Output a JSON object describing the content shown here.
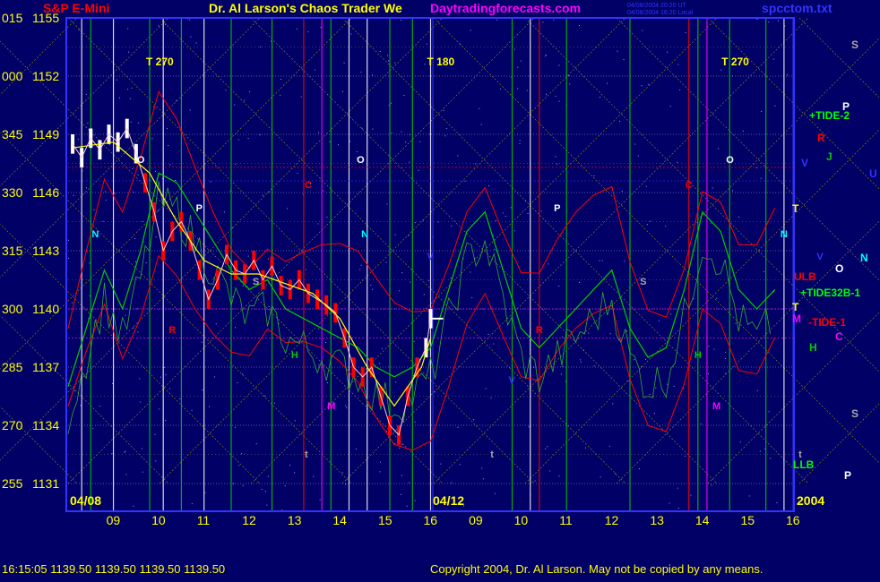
{
  "header": {
    "symbol": "S&P E-Mini",
    "title": "Dr. Al Larson's Chaos Trader We",
    "site": "Daytradingforecasts.com",
    "file": "spcctom.txt",
    "stamp1": "04/08/2004 20:20 UT",
    "stamp2": "04/08/2004 16:20 Local"
  },
  "footer": {
    "quote": "16:15:05   1139.50 1139.50 1139.50 1139.50",
    "copyright": "Copyright 2004, Dr. Al Larson. May not be copied by any means."
  },
  "colors": {
    "background": "#000066",
    "plot_border": "#3333ff",
    "yellow": "#ffff00",
    "white": "#ffffff",
    "red": "#ff0000",
    "green": "#00cc00",
    "magenta": "#ff00ff",
    "cyan": "#00ffff",
    "blue": "#3333ff"
  },
  "chart_data": {
    "type": "line",
    "title": "S&P E-Mini",
    "y_ticks": [
      {
        "angle": "015",
        "price": "1155"
      },
      {
        "angle": "000",
        "price": "1152"
      },
      {
        "angle": "345",
        "price": "1149"
      },
      {
        "angle": "330",
        "price": "1146"
      },
      {
        "angle": "315",
        "price": "1143"
      },
      {
        "angle": "300",
        "price": "1140"
      },
      {
        "angle": "285",
        "price": "1137"
      },
      {
        "angle": "270",
        "price": "1134"
      },
      {
        "angle": "255",
        "price": "1131"
      }
    ],
    "ylim": [
      1131,
      1155
    ],
    "x_ticks": [
      "09",
      "10",
      "11",
      "12",
      "13",
      "14",
      "15",
      "16",
      "09",
      "10",
      "11",
      "12",
      "13",
      "14",
      "15",
      "16"
    ],
    "date_labels": [
      "04/08",
      "04/12",
      "2004"
    ],
    "price_series": {
      "name": "S&P E-Mini",
      "x": [
        8.1,
        8.3,
        8.5,
        8.7,
        8.9,
        9.1,
        9.3,
        9.5,
        9.7,
        9.9,
        10.1,
        10.3,
        10.5,
        10.7,
        10.9,
        11.1,
        11.3,
        11.5,
        11.7,
        11.9,
        12.1,
        12.3,
        12.5,
        12.7,
        12.9,
        13.1,
        13.3,
        13.5,
        13.7,
        13.9,
        14.1,
        14.3,
        14.5,
        14.7,
        14.9,
        15.1,
        15.3,
        15.5,
        15.7,
        15.9,
        16.0
      ],
      "values": [
        1148.5,
        1147.8,
        1148.8,
        1148.2,
        1149.0,
        1148.6,
        1149.3,
        1148.0,
        1146.5,
        1145.0,
        1143.0,
        1144.0,
        1144.5,
        1143.5,
        1142.0,
        1140.5,
        1141.5,
        1142.8,
        1142.0,
        1141.8,
        1142.5,
        1141.5,
        1142.2,
        1141.2,
        1141.0,
        1141.5,
        1140.8,
        1140.5,
        1140.2,
        1139.8,
        1138.5,
        1137.0,
        1136.5,
        1137.0,
        1135.5,
        1134.0,
        1133.5,
        1135.5,
        1137.0,
        1138.0,
        1139.5
      ]
    },
    "tide_series": {
      "name": "green tide",
      "x": [
        8.0,
        8.4,
        8.8,
        9.2,
        9.6,
        10.0,
        10.4,
        10.8,
        11.2,
        11.6,
        12.0,
        12.4,
        12.8,
        13.2,
        13.6,
        14.0,
        14.4,
        14.8,
        15.2,
        15.6,
        16.0,
        16.4,
        16.8,
        17.2,
        17.6,
        18.0,
        18.4,
        18.8,
        19.2,
        19.6,
        20.0,
        20.4,
        20.8,
        21.2,
        21.6,
        22.0,
        22.4,
        22.8,
        23.2,
        23.6
      ],
      "values": [
        1136,
        1139,
        1142,
        1140,
        1143,
        1147,
        1146.5,
        1145,
        1143.5,
        1142,
        1141,
        1141.5,
        1140,
        1139.5,
        1139,
        1138.5,
        1138,
        1137,
        1136.5,
        1137,
        1138,
        1141,
        1144,
        1145,
        1142,
        1139,
        1138,
        1139,
        1140,
        1141,
        1142,
        1139,
        1137.5,
        1138,
        1141,
        1145,
        1144,
        1141,
        1140,
        1141
      ]
    },
    "ma_series": {
      "name": "yellow average",
      "x": [
        8.1,
        9.0,
        9.8,
        10.4,
        11.0,
        11.6,
        12.2,
        12.8,
        13.4,
        14.0,
        14.6,
        15.2,
        15.8,
        16.0
      ],
      "values": [
        1148.3,
        1148.6,
        1147.0,
        1144.5,
        1142.5,
        1141.8,
        1141.8,
        1141.3,
        1140.8,
        1139.5,
        1137.0,
        1135.0,
        1137.0,
        1138.5
      ]
    },
    "legend_labels": [
      {
        "text": "+TIDE-2",
        "color": "#00ff00"
      },
      {
        "text": "R",
        "color": "#ff0000"
      },
      {
        "text": "J",
        "color": "#00cc00"
      },
      {
        "text": "V",
        "color": "#3333ff"
      },
      {
        "text": "U",
        "color": "#3333ff"
      },
      {
        "text": "T",
        "color": "#ffff00"
      },
      {
        "text": "ULB",
        "color": "#ff0000"
      },
      {
        "text": "O",
        "color": "#ffffff"
      },
      {
        "text": "N",
        "color": "#00ffff"
      },
      {
        "text": "+TIDE32B-1",
        "color": "#00ff00"
      },
      {
        "text": "T",
        "color": "#ffff00"
      },
      {
        "text": "M",
        "color": "#ff00ff"
      },
      {
        "text": "-TIDE-1",
        "color": "#ff0000"
      },
      {
        "text": "C",
        "color": "#ff00ff"
      },
      {
        "text": "H",
        "color": "#00cc00"
      },
      {
        "text": "S",
        "color": "#aaaaaa"
      },
      {
        "text": "S",
        "color": "#aaaaaa"
      },
      {
        "text": "P",
        "color": "#ffffff"
      },
      {
        "text": "LLB",
        "color": "#00ff00"
      },
      {
        "text": "P",
        "color": "#ffffff"
      }
    ],
    "marker_labels": [
      {
        "text": "T 270",
        "x": 9.8,
        "color": "#ffff00"
      },
      {
        "text": "T 180",
        "x": 16.0,
        "color": "#ffff00"
      },
      {
        "text": "T 270",
        "x": 22.5,
        "color": "#ffff00"
      },
      {
        "text": "O",
        "x": 9.6,
        "color": "#ffffff"
      },
      {
        "text": "O",
        "x": 14.45,
        "color": "#ffffff"
      },
      {
        "text": "O",
        "x": 22.6,
        "color": "#ffffff"
      },
      {
        "text": "P",
        "x": 10.9,
        "color": "#ffffff"
      },
      {
        "text": "P",
        "x": 18.8,
        "color": "#ffffff"
      },
      {
        "text": "C",
        "x": 13.3,
        "color": "#ff0000"
      },
      {
        "text": "C",
        "x": 21.7,
        "color": "#ff0000"
      },
      {
        "text": "N",
        "x": 8.6,
        "color": "#00ffff"
      },
      {
        "text": "N",
        "x": 14.55,
        "color": "#00ffff"
      },
      {
        "text": "N",
        "x": 23.8,
        "color": "#00ffff"
      },
      {
        "text": "S",
        "x": 12.15,
        "color": "#aaaaaa"
      },
      {
        "text": "S",
        "x": 20.7,
        "color": "#aaaaaa"
      },
      {
        "text": "H",
        "x": 13.0,
        "color": "#00cc00"
      },
      {
        "text": "H",
        "x": 21.9,
        "color": "#00cc00"
      },
      {
        "text": "M",
        "x": 13.8,
        "color": "#ff00ff"
      },
      {
        "text": "M",
        "x": 22.3,
        "color": "#ff00ff"
      },
      {
        "text": "R",
        "x": 10.3,
        "color": "#ff0000"
      },
      {
        "text": "R",
        "x": 18.4,
        "color": "#ff0000"
      },
      {
        "text": "t",
        "x": 13.3,
        "color": "#aaaaaa"
      },
      {
        "text": "t",
        "x": 17.4,
        "color": "#aaaaaa"
      },
      {
        "text": "t",
        "x": 24.2,
        "color": "#aaaaaa"
      },
      {
        "text": "V",
        "x": 16.0,
        "color": "#3333ff"
      },
      {
        "text": "V",
        "x": 17.8,
        "color": "#3333ff"
      },
      {
        "text": "V",
        "x": 24.6,
        "color": "#3333ff"
      }
    ],
    "grid": true
  }
}
